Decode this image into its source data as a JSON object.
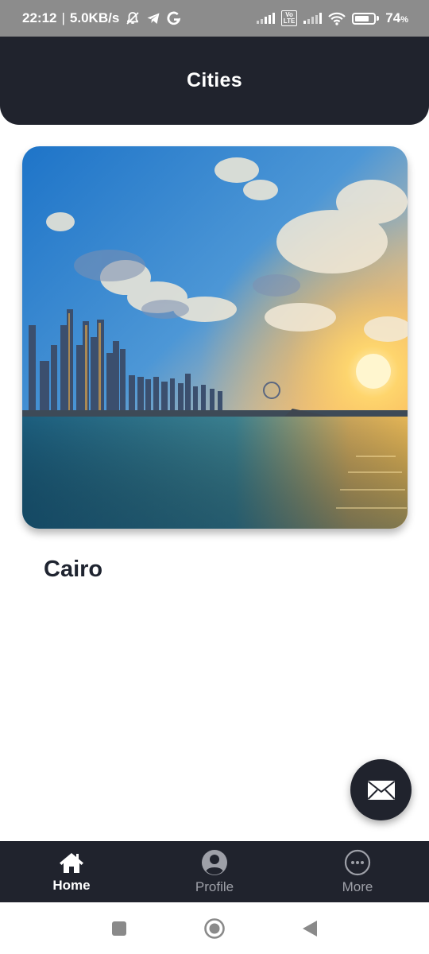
{
  "status_bar": {
    "time": "22:12",
    "separator": "|",
    "net_speed": "5.0KB/s",
    "battery_percent": "74",
    "battery_unit": "%",
    "volte_label": "Vo\nLTE",
    "icons": [
      "bell-off-icon",
      "telegram-icon",
      "google-icon",
      "signal-icon",
      "volte-icon",
      "signal-icon",
      "wifi-icon",
      "battery-icon"
    ]
  },
  "app_bar": {
    "title": "Cities"
  },
  "city_card": {
    "image_icon": "city-skyline-sunset-image",
    "name": "Cairo"
  },
  "fab": {
    "icon": "mail-icon"
  },
  "bottom_nav": {
    "items": [
      {
        "label": "Home",
        "icon": "home-icon",
        "active": true
      },
      {
        "label": "Profile",
        "icon": "user-circle-icon",
        "active": false
      },
      {
        "label": "More",
        "icon": "more-horizontal-icon",
        "active": false
      }
    ]
  },
  "system_nav": {
    "icons": [
      "recents-square-icon",
      "home-circle-icon",
      "back-triangle-icon"
    ]
  },
  "colors": {
    "primary_dark": "#20232d",
    "status_bar": "#8c8c8c",
    "inactive_nav": "#9ea0a8",
    "city_text": "#1f2430"
  }
}
